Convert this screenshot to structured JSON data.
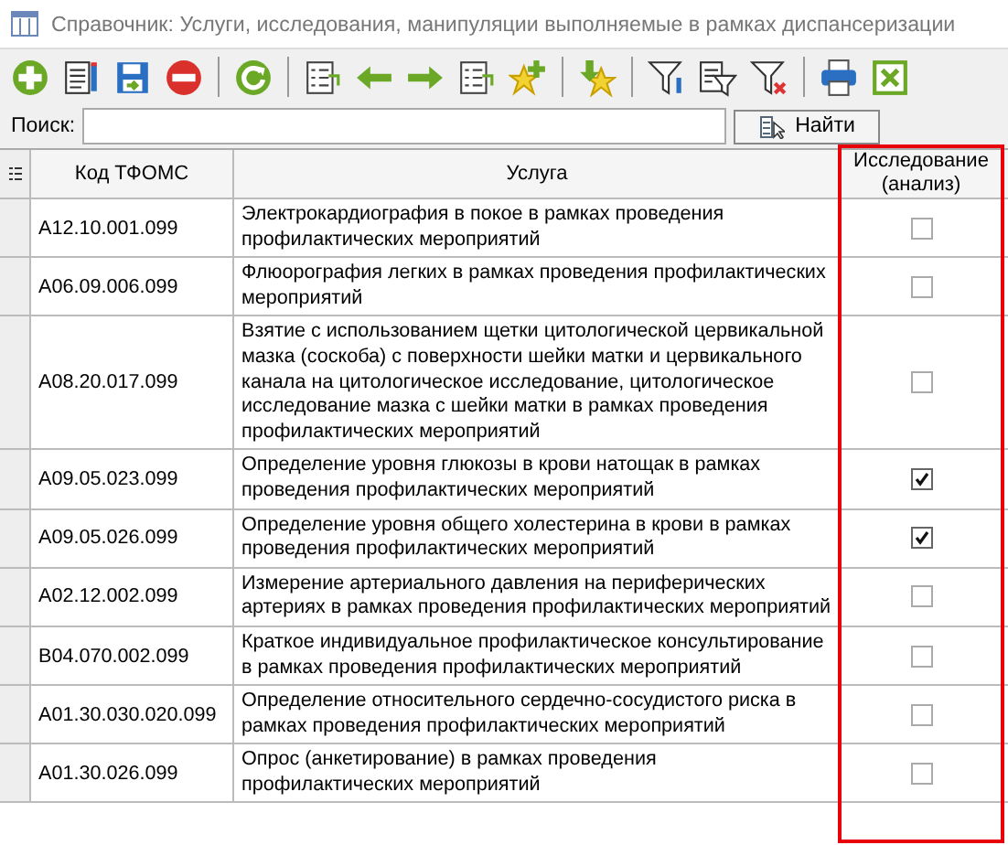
{
  "window": {
    "title": "Справочник: Услуги, исследования, манипуляции выполняемые в рамках диспансеризации"
  },
  "toolbar": [
    {
      "kind": "add"
    },
    {
      "kind": "edit"
    },
    {
      "kind": "save"
    },
    {
      "kind": "delete"
    },
    {
      "kind": "sep"
    },
    {
      "kind": "refresh"
    },
    {
      "kind": "sep"
    },
    {
      "kind": "list-left"
    },
    {
      "kind": "left"
    },
    {
      "kind": "right"
    },
    {
      "kind": "list-right"
    },
    {
      "kind": "star-add"
    },
    {
      "kind": "sep"
    },
    {
      "kind": "star-down"
    },
    {
      "kind": "sep"
    },
    {
      "kind": "filter-set"
    },
    {
      "kind": "filter-doc"
    },
    {
      "kind": "filter-clear"
    },
    {
      "kind": "sep"
    },
    {
      "kind": "print"
    },
    {
      "kind": "excel"
    }
  ],
  "search": {
    "label": "Поиск:",
    "button": "Найти"
  },
  "table": {
    "columns": [
      "Код ТФОМС",
      "Услуга",
      "Исследование (анализ)"
    ],
    "rows": [
      {
        "code": "A12.10.001.099",
        "service": "Электрокардиография в покое в рамках проведения профилактических мероприятий",
        "checked": false
      },
      {
        "code": "A06.09.006.099",
        "service": "Флюорография легких в рамках проведения профилактических мероприятий",
        "checked": false
      },
      {
        "code": "A08.20.017.099",
        "service": "Взятие с использованием щетки цитологической цервикальной мазка (соскоба) с поверхности шейки матки и цервикального канала на цитологическое исследование, цитологическое исследование мазка с шейки матки в рамках проведения профилактических мероприятий",
        "checked": false
      },
      {
        "code": "A09.05.023.099",
        "service": "Определение уровня глюкозы в крови натощак в рамках проведения профилактических мероприятий",
        "checked": true
      },
      {
        "code": "A09.05.026.099",
        "service": "Определение уровня общего холестерина в крови в рамках проведения профилактических мероприятий",
        "checked": true
      },
      {
        "code": "A02.12.002.099",
        "service": "Измерение артериального давления на периферических артериях в рамках проведения профилактических мероприятий",
        "checked": false
      },
      {
        "code": "B04.070.002.099",
        "service": "Краткое индивидуальное профилактическое консультирование в рамках проведения профилактических мероприятий",
        "checked": false
      },
      {
        "code": "A01.30.030.020.099",
        "service": "Определение относительного сердечно-сосудистого риска в рамках проведения профилактических мероприятий",
        "checked": false
      },
      {
        "code": "A01.30.026.099",
        "service": "Опрос (анкетирование) в рамках проведения профилактических мероприятий",
        "checked": false
      }
    ]
  }
}
